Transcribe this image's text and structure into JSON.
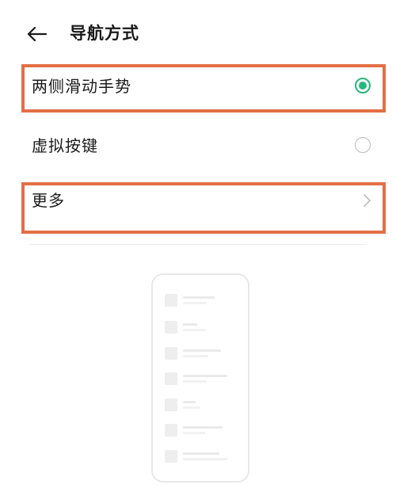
{
  "header": {
    "back_icon": "arrow-left-icon",
    "title": "导航方式"
  },
  "options": [
    {
      "label": "两侧滑动手势",
      "type": "radio",
      "selected": true,
      "highlighted": true
    },
    {
      "label": "虚拟按键",
      "type": "radio",
      "selected": false,
      "highlighted": false
    },
    {
      "label": "更多",
      "type": "link",
      "icon": "chevron-right-icon",
      "highlighted": true
    }
  ],
  "preview": {
    "icon": "phone-preview",
    "rows": 7
  },
  "colors": {
    "accent_green": "#27b87c",
    "highlight_orange": "#e46f45",
    "radio_off_gray": "#b9b9b9"
  }
}
